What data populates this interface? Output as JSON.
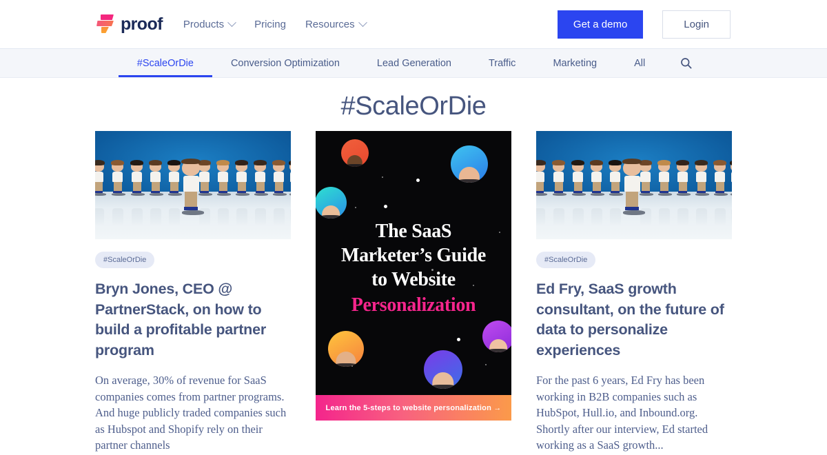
{
  "header": {
    "brand_name": "proof",
    "logo_icon": "proof-flag-logo",
    "nav": [
      {
        "label": "Products",
        "has_caret": true
      },
      {
        "label": "Pricing",
        "has_caret": false
      },
      {
        "label": "Resources",
        "has_caret": true
      }
    ],
    "demo_button": "Get a demo",
    "login_button": "Login",
    "demo_button_color": "#2B45F0"
  },
  "subnav": {
    "items": [
      {
        "label": "#ScaleOrDie",
        "active": true
      },
      {
        "label": "Conversion Optimization",
        "active": false
      },
      {
        "label": "Lead Generation",
        "active": false
      },
      {
        "label": "Traffic",
        "active": false
      },
      {
        "label": "Marketing",
        "active": false
      },
      {
        "label": "All",
        "active": false
      }
    ],
    "search_icon": "search-icon",
    "active_color": "#2B45F0",
    "background": "#F4F6FA"
  },
  "page": {
    "title": "#ScaleOrDie",
    "title_color": "#46557E"
  },
  "cards": [
    {
      "tag": "#ScaleOrDie",
      "title": "Bryn Jones, CEO @ PartnerStack, on how to build a profitable partner program",
      "excerpt": "On average, 30% of revenue for SaaS companies comes from partner programs. And huge publicly traded companies such as Hubspot and Shopify rely on their partner channels",
      "thumbnail": "bobblehead-team-photo"
    },
    {
      "thumbnail": "saas-personalization-ebook-cover",
      "ebook": {
        "title_line1": "The SaaS",
        "title_line2": "Marketer’s Guide",
        "title_line3": "to Website",
        "title_accent": "Personalization",
        "accent_color": "#F5258C",
        "cta": "Learn the 5-steps to website personalization →"
      }
    },
    {
      "tag": "#ScaleOrDie",
      "title": "Ed Fry, SaaS growth consultant, on the future of data to personalize experiences",
      "excerpt": "For the past 6 years, Ed Fry has been working in B2B companies such as HubSpot, Hull.io, and Inbound.org. Shortly after our interview, Ed started working as a SaaS growth...",
      "thumbnail": "bobblehead-team-photo"
    }
  ]
}
